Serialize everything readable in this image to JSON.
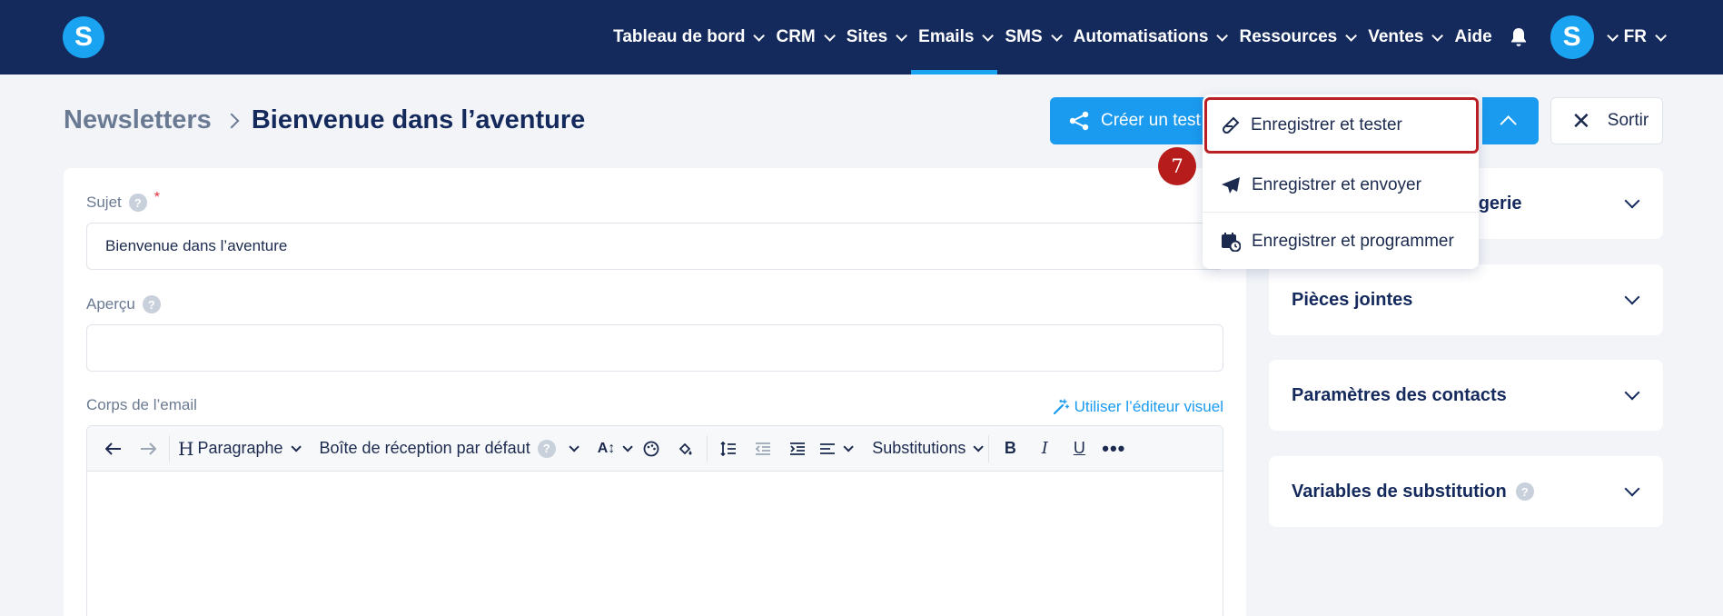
{
  "nav": {
    "logo": "S",
    "items": [
      {
        "label": "Tableau de bord",
        "chevron": true
      },
      {
        "label": "CRM",
        "chevron": true
      },
      {
        "label": "Sites",
        "chevron": true
      },
      {
        "label": "Emails",
        "chevron": true,
        "active": true
      },
      {
        "label": "SMS",
        "chevron": true
      },
      {
        "label": "Automatisations",
        "chevron": true
      },
      {
        "label": "Ressources",
        "chevron": true
      },
      {
        "label": "Ventes",
        "chevron": true
      },
      {
        "label": "Aide",
        "chevron": false
      }
    ],
    "avatar": "S",
    "language": "FR"
  },
  "breadcrumb": {
    "root": "Newsletters",
    "current": "Bienvenue dans l’aventure"
  },
  "actions": {
    "create_test": "Créer un test",
    "exit": "Sortir"
  },
  "dropdown": {
    "items": [
      "Enregistrer et tester",
      "Enregistrer et envoyer",
      "Enregistrer et programmer"
    ]
  },
  "step_badge": "7",
  "form": {
    "subject_label": "Sujet",
    "subject_value": "Bienvenue dans l’aventure",
    "preview_label": "Aperçu",
    "preview_value": "",
    "body_label": "Corps de l’email",
    "visual_editor_link": "Utiliser l’éditeur visuel",
    "help_mark": "?",
    "required_mark": "*"
  },
  "toolbar": {
    "paragraph": "Paragraphe",
    "inbox": "Boîte de réception par défaut",
    "substitutions": "Substitutions"
  },
  "panels": {
    "messaging": "Paramètres de messagerie",
    "attachments": "Pièces jointes",
    "contacts": "Paramètres des contacts",
    "variables": "Variables de substitution"
  },
  "colors": {
    "navbar": "#14295c",
    "accent": "#1a9bf0",
    "highlight": "#b82025"
  }
}
